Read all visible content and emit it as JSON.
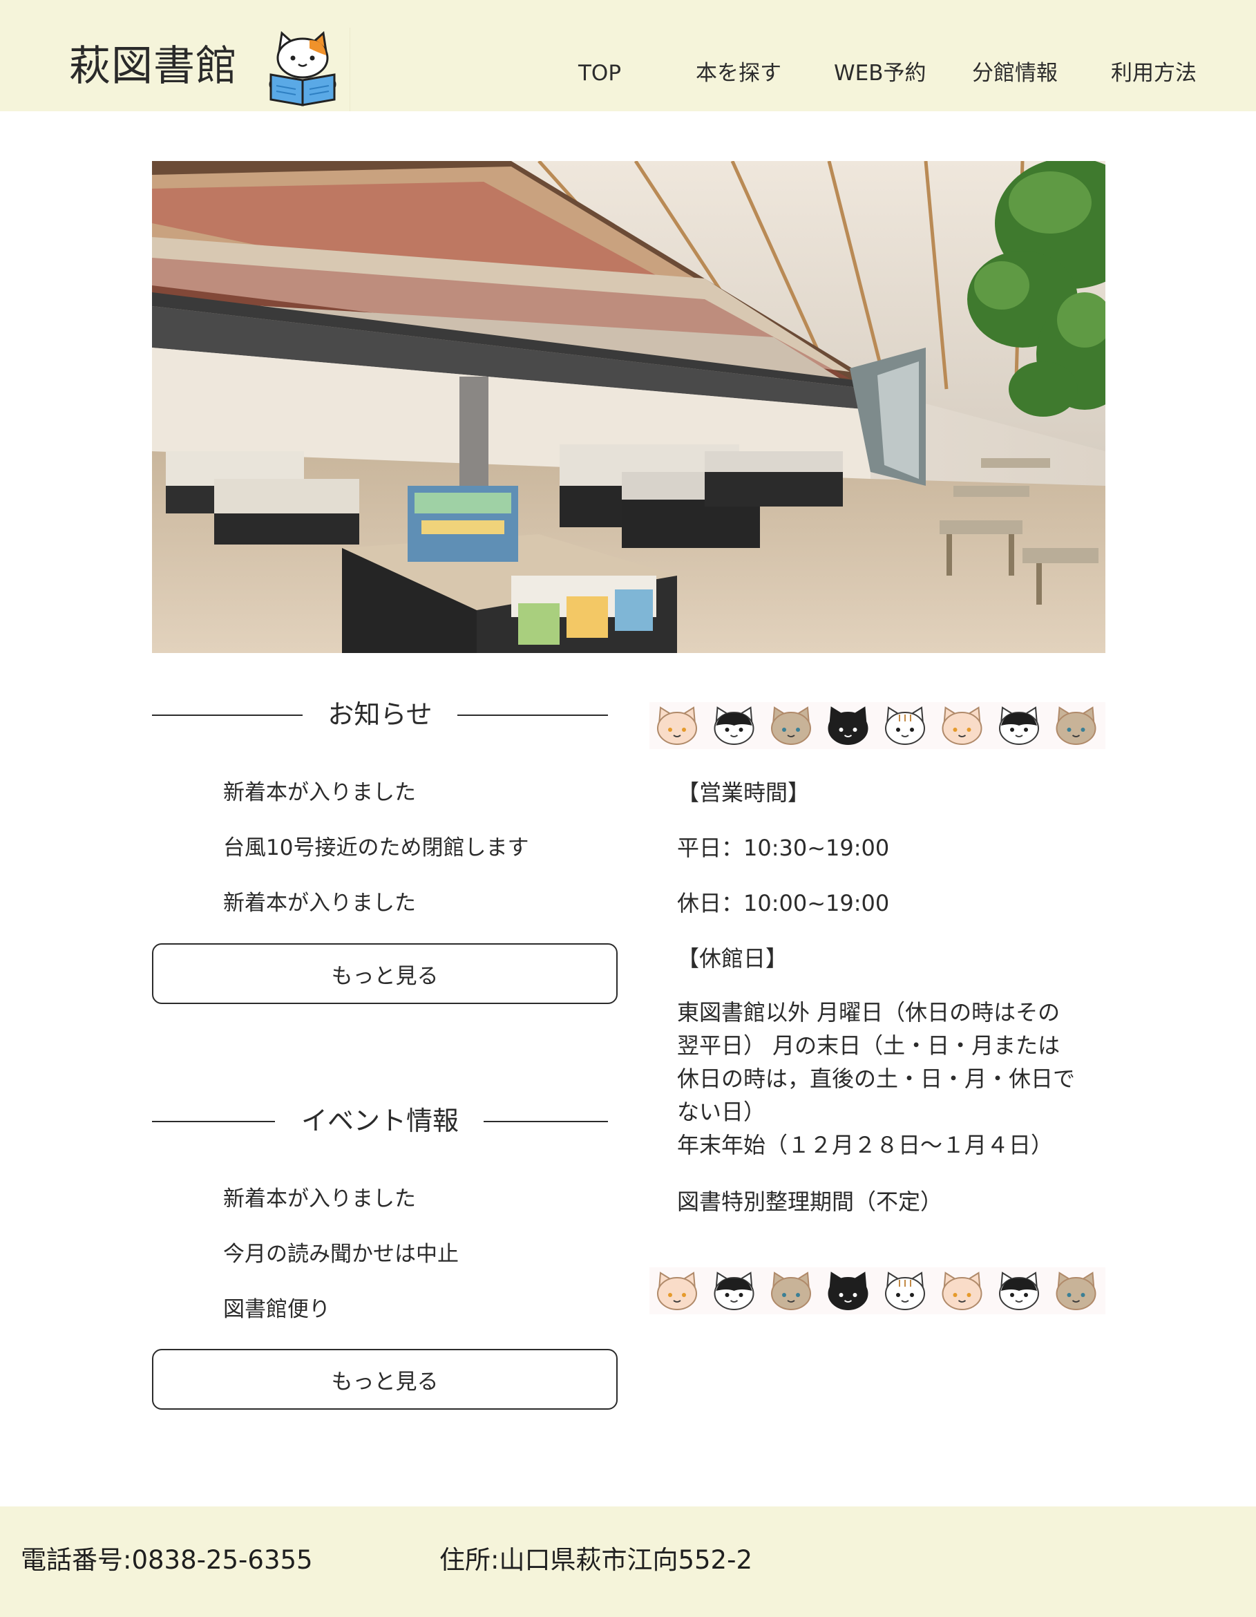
{
  "header": {
    "logo_text": "萩図書館",
    "logo_icon": "cat-reading-book-icon",
    "nav": [
      "TOP",
      "本を探す",
      "WEB予約",
      "分館情報",
      "利用方法"
    ]
  },
  "hero": {
    "description_icon": "library-interior-photo"
  },
  "news": {
    "title": "お知らせ",
    "items": [
      "新着本が入りました",
      "台風10号接近のため閉館します",
      "新着本が入りました"
    ],
    "more_label": "もっと見る"
  },
  "events": {
    "title": "イベント情報",
    "items": [
      "新着本が入りました",
      "今月の読み聞かせは中止",
      "図書館便り"
    ],
    "more_label": "もっと見る"
  },
  "hours": {
    "heading": "【営業時間】",
    "weekday": "平日：10:30~19:00",
    "holiday": "休日：10:00~19:00"
  },
  "closed": {
    "heading": "【休館日】",
    "lines": [
      "東図書館以外 月曜日（休日の時はその",
      "翌平日） 月の末日（土・日・月または",
      "休日の時は，直後の土・日・月・休日で",
      "ない日）",
      "年末年始（１２月２８日〜１月４日）"
    ],
    "special": "図書特別整理期間（不定）"
  },
  "cat_border": {
    "icon": "cat-faces-border",
    "colors": [
      "#f9dcc8",
      "#ffffff",
      "#c8b398",
      "#1e1e1e",
      "#ffffff",
      "#f9dcc8",
      "#ffffff",
      "#c8b398"
    ]
  },
  "footer": {
    "phone": "電話番号:0838-25-6355",
    "address": "住所:山口県萩市江向552-2"
  }
}
